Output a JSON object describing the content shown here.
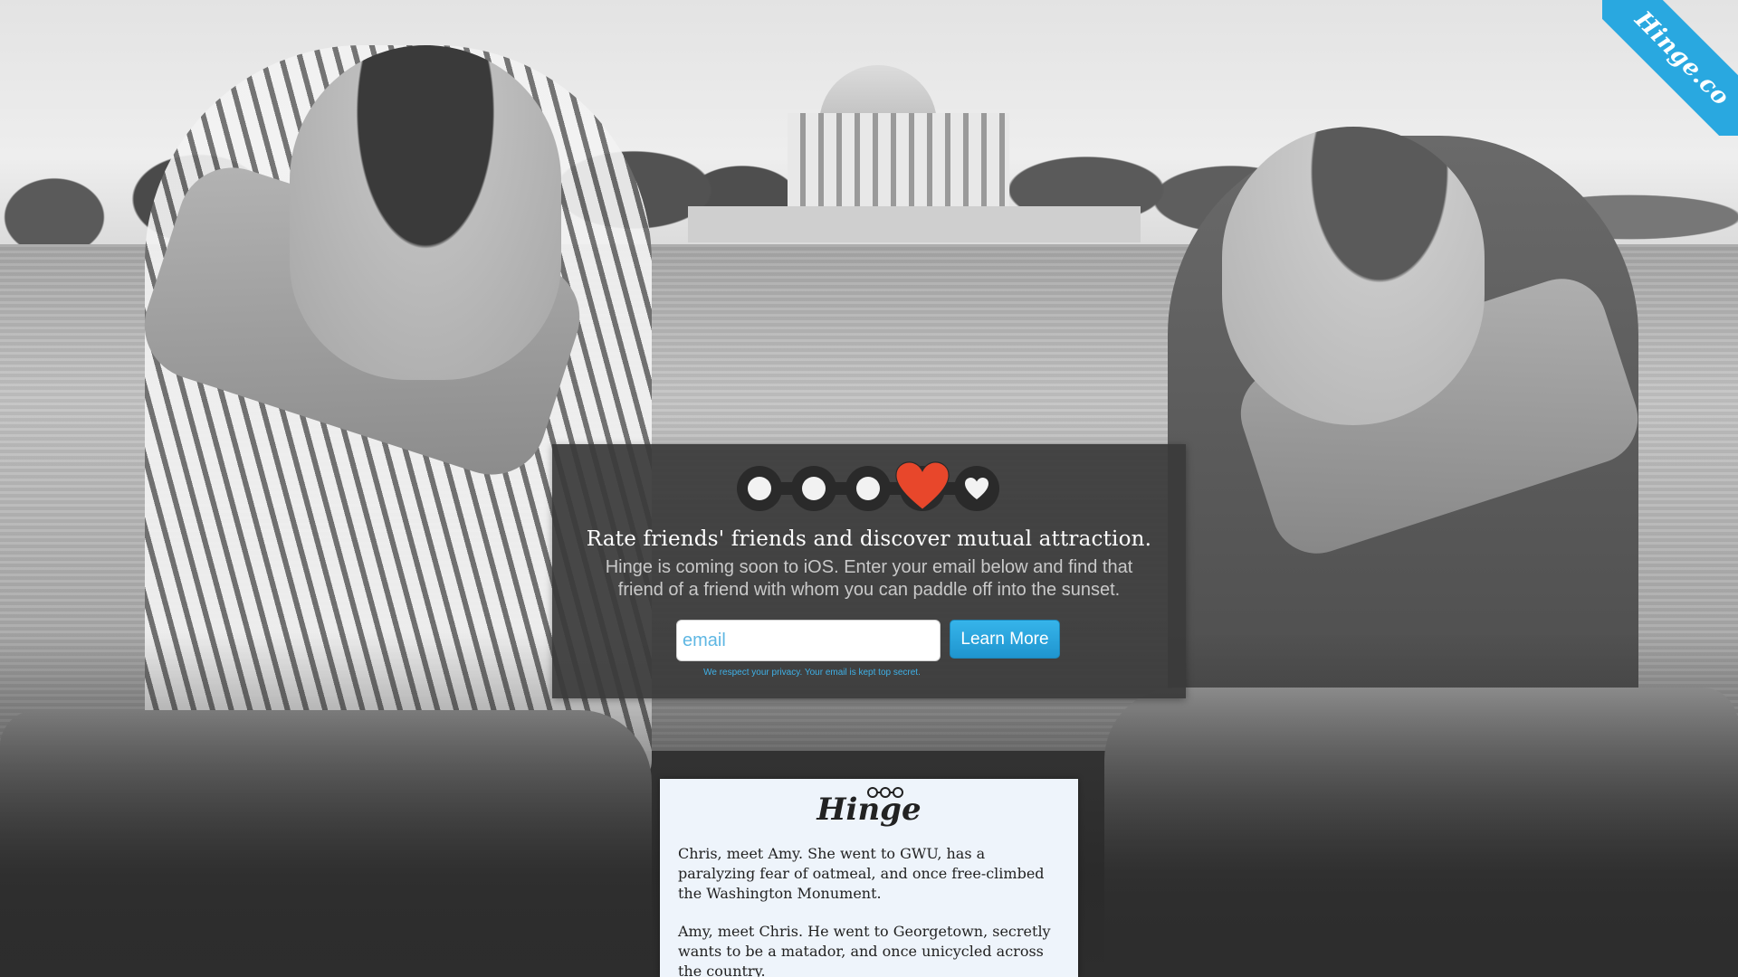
{
  "ribbon": {
    "label": "Hinge.co"
  },
  "rating": {
    "steps": [
      "circle",
      "circle",
      "circle",
      "heart-filled",
      "heart"
    ],
    "selected_index": 3,
    "colors": {
      "selected": "#e8472b",
      "unselected": "#f2f2f2",
      "track": "#2a2a2a"
    }
  },
  "signup": {
    "headline": "Rate friends' friends and discover mutual attraction.",
    "subtext": "Hinge is coming soon to iOS. Enter your email below and find that friend of a friend with whom you can paddle off into the sunset.",
    "email_placeholder": "email",
    "email_value": "",
    "button_label": "Learn More",
    "privacy_note": "We respect your privacy. Your email is kept top secret."
  },
  "card": {
    "logo": "Hinge",
    "paragraph_1": "Chris, meet Amy. She went to GWU, has a paralyzing fear of oatmeal, and once free-climbed the Washington Monument.",
    "paragraph_2": "Amy, meet Chris. He went to Georgetown, secretly wants to be a matador, and once unicycled across the country."
  },
  "colors": {
    "accent": "#29a8e0",
    "panel_bg": "#3a3a3a",
    "card_bg": "#eef4fb",
    "heart": "#e8472b"
  }
}
